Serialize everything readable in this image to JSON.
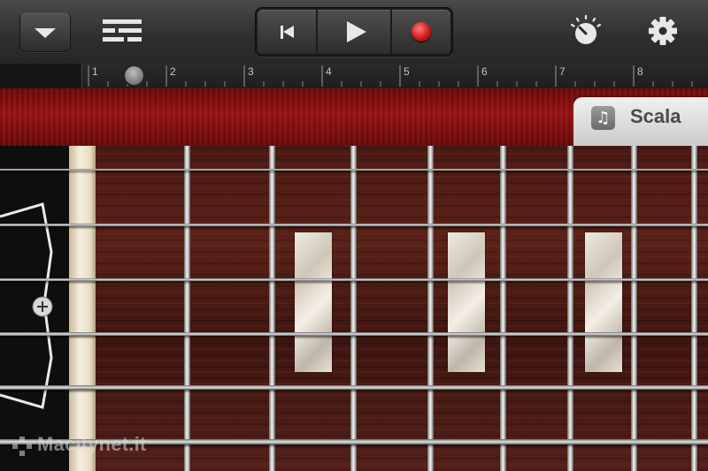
{
  "toolbar": {
    "menu_icon": "chevron-down-icon",
    "tracks_icon": "tracks-view-icon",
    "transport": {
      "rewind_icon": "rewind-icon",
      "play_icon": "play-icon",
      "record_icon": "record-icon",
      "record_color": "#d11818"
    },
    "knob_icon": "tempo-knob-icon",
    "settings_icon": "gear-icon"
  },
  "ruler": {
    "bars": [
      "1",
      "2",
      "3",
      "4",
      "5",
      "6",
      "7",
      "8"
    ],
    "playhead_bar": 1.5
  },
  "instrument": {
    "tab_label": "Scala",
    "tab_icon": "music-note-icon",
    "body_color": "#8c1010",
    "string_count": 6,
    "fret_count": 8,
    "inlay_frets": [
      3,
      5,
      7
    ]
  },
  "watermark": {
    "text": "Macitynet.it"
  }
}
